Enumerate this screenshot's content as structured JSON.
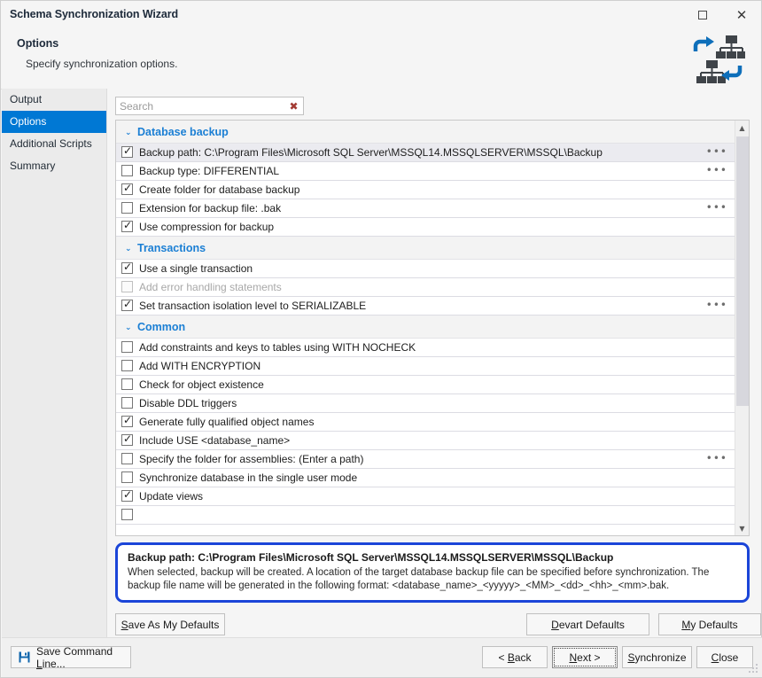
{
  "window": {
    "title": "Schema Synchronization Wizard",
    "maximize_glyph": "□",
    "close_glyph": "✕"
  },
  "header": {
    "title": "Options",
    "subtitle": "Specify synchronization options.",
    "icon_name": "schema-sync-icon"
  },
  "sidebar": {
    "items": [
      {
        "label": "Output",
        "active": false
      },
      {
        "label": "Options",
        "active": true
      },
      {
        "label": "Additional Scripts",
        "active": false
      },
      {
        "label": "Summary",
        "active": false
      }
    ]
  },
  "search": {
    "value": "",
    "placeholder": "Search",
    "clear_glyph": "✖"
  },
  "options": {
    "caret_glyph": "⌄",
    "ellipsis_glyph": "•••",
    "check_glyph": "✓",
    "groups": [
      {
        "name": "Database backup",
        "rows": [
          {
            "label": "Backup path: C:\\Program Files\\Microsoft SQL Server\\MSSQL14.MSSQLSERVER\\MSSQL\\Backup",
            "checked": true,
            "selected": true,
            "disabled": false,
            "ellipsis": true
          },
          {
            "label": "Backup type: DIFFERENTIAL",
            "checked": false,
            "selected": false,
            "disabled": false,
            "ellipsis": true
          },
          {
            "label": "Create folder for database backup",
            "checked": true,
            "selected": false,
            "disabled": false,
            "ellipsis": false
          },
          {
            "label": "Extension for backup file: .bak",
            "checked": false,
            "selected": false,
            "disabled": false,
            "ellipsis": true
          },
          {
            "label": "Use compression for backup",
            "checked": true,
            "selected": false,
            "disabled": false,
            "ellipsis": false
          }
        ]
      },
      {
        "name": "Transactions",
        "rows": [
          {
            "label": "Use a single transaction",
            "checked": true,
            "selected": false,
            "disabled": false,
            "ellipsis": false
          },
          {
            "label": "Add error handling statements",
            "checked": false,
            "selected": false,
            "disabled": true,
            "ellipsis": false
          },
          {
            "label": "Set transaction isolation level to SERIALIZABLE",
            "checked": true,
            "selected": false,
            "disabled": false,
            "ellipsis": true
          }
        ]
      },
      {
        "name": "Common",
        "rows": [
          {
            "label": "Add constraints and keys to tables using WITH NOCHECK",
            "checked": false,
            "selected": false,
            "disabled": false,
            "ellipsis": false
          },
          {
            "label": "Add WITH ENCRYPTION",
            "checked": false,
            "selected": false,
            "disabled": false,
            "ellipsis": false
          },
          {
            "label": "Check for object existence",
            "checked": false,
            "selected": false,
            "disabled": false,
            "ellipsis": false
          },
          {
            "label": "Disable DDL triggers",
            "checked": false,
            "selected": false,
            "disabled": false,
            "ellipsis": false
          },
          {
            "label": "Generate fully qualified object names",
            "checked": true,
            "selected": false,
            "disabled": false,
            "ellipsis": false
          },
          {
            "label": "Include USE <database_name>",
            "checked": true,
            "selected": false,
            "disabled": false,
            "ellipsis": false
          },
          {
            "label": "Specify the folder for assemblies: (Enter a path)",
            "checked": false,
            "selected": false,
            "disabled": false,
            "ellipsis": true
          },
          {
            "label": "Synchronize database in the single user mode",
            "checked": false,
            "selected": false,
            "disabled": false,
            "ellipsis": false
          },
          {
            "label": "Update views",
            "checked": true,
            "selected": false,
            "disabled": false,
            "ellipsis": false
          },
          {
            "label": "",
            "checked": false,
            "selected": false,
            "disabled": false,
            "ellipsis": false
          }
        ]
      }
    ]
  },
  "scrollbar": {
    "up_glyph": "▲",
    "down_glyph": "▼"
  },
  "description": {
    "title": "Backup path: C:\\Program Files\\Microsoft SQL Server\\MSSQL14.MSSQLSERVER\\MSSQL\\Backup",
    "body": "When selected, backup will be created. A location of the target database backup file can be specified before synchronization. The backup file name will be generated in the following format: <database_name>_<yyyyy>_<MM>_<dd>_<hh>_<mm>.bak.",
    "border_color": "#1b45d8"
  },
  "defaults_buttons": {
    "save_as_my_defaults": "Save As My Defaults",
    "devart_defaults": "Devart Defaults",
    "my_defaults": "My Defaults"
  },
  "footer": {
    "save_command_line": "Save Command Line...",
    "save_icon_name": "floppy-disk-icon",
    "back": "< Back",
    "next": "Next >",
    "synchronize": "Synchronize",
    "close": "Close"
  },
  "colors": {
    "accent": "#0078d4",
    "group_header": "#1b7fd4",
    "highlight_border": "#1b45d8"
  }
}
